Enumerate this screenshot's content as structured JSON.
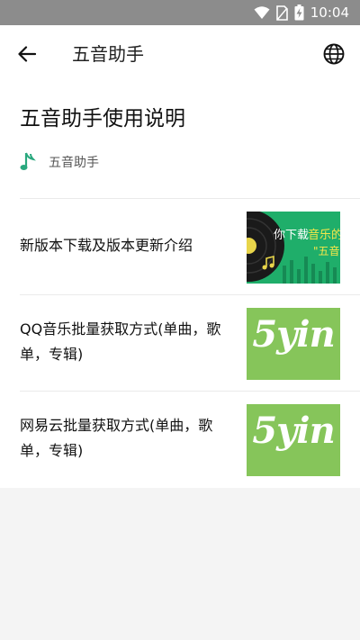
{
  "status_bar": {
    "time": "10:04"
  },
  "app_bar": {
    "title": "五音助手"
  },
  "document": {
    "title": "五音助手使用说明",
    "author": "五音助手"
  },
  "articles": [
    {
      "title": "新版本下载及版本更新介绍",
      "thumb_text_1": "你下载",
      "thumb_text_2": "音乐的",
      "thumb_text_3": "\"五音"
    },
    {
      "title": "QQ音乐批量获取方式(单曲，歌单，专辑)",
      "thumb_text": "5yin"
    },
    {
      "title": "网易云批量获取方式(单曲，歌单，专辑)",
      "thumb_text": "5yin"
    }
  ],
  "colors": {
    "accent": "#2aa87e",
    "thumb_green": "#86c55a",
    "thumb_music": "#1fae6a",
    "status_bar": "#8c8c8c"
  }
}
